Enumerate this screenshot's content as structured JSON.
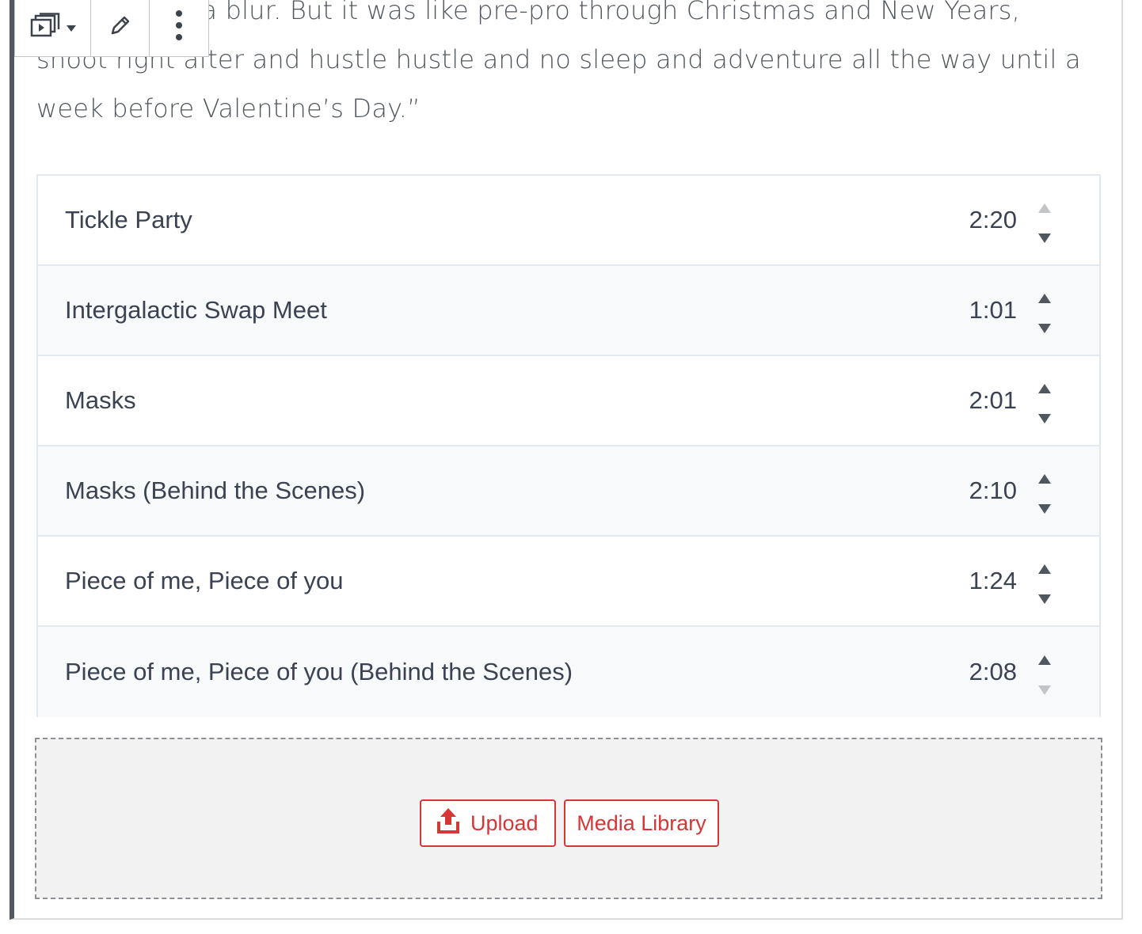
{
  "intro_text": "It’s really all a blur. But it was like pre-pro through Christmas and New Years, shoot right after and hustle hustle and no sleep and adventure all the way until a week before Valentine’s Day.”",
  "toolbar": {
    "switcher_icon": "playlist-icon",
    "edit_icon": "pencil-icon",
    "more_icon": "more-vertical-icon"
  },
  "tracks": [
    {
      "title": "Tickle Party",
      "duration": "2:20"
    },
    {
      "title": "Intergalactic Swap Meet",
      "duration": "1:01"
    },
    {
      "title": "Masks",
      "duration": "2:01"
    },
    {
      "title": "Masks (Behind the Scenes)",
      "duration": "2:10"
    },
    {
      "title": "Piece of me, Piece of you",
      "duration": "1:24"
    },
    {
      "title": "Piece of me, Piece of you (Behind the Scenes)",
      "duration": "2:08"
    }
  ],
  "placeholder": {
    "upload_label": "Upload",
    "media_library_label": "Media Library"
  },
  "colors": {
    "accent": "#d63638",
    "text": "#3b4252",
    "row_alt": "#f7f9fb",
    "border": "#e2e8f0"
  }
}
